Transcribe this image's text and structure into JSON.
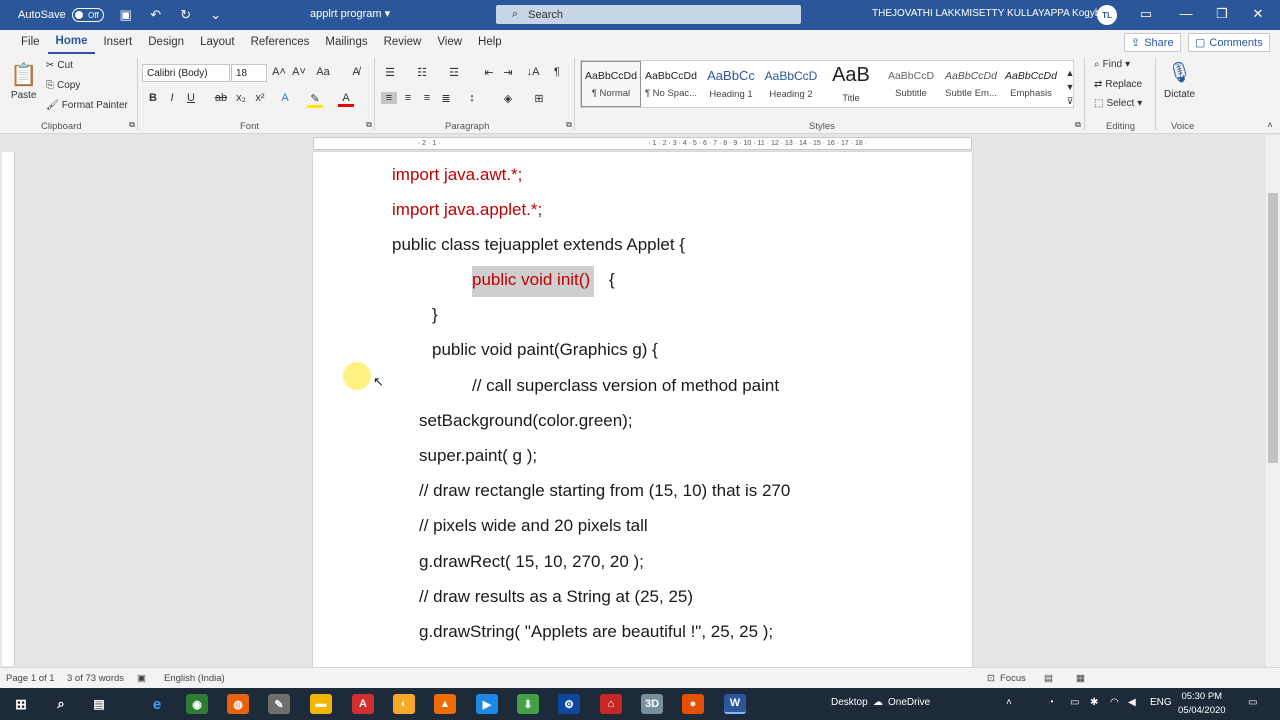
{
  "titlebar": {
    "autosave_label": "AutoSave",
    "autosave_state": "Off",
    "doc_title": "applrt program",
    "search_placeholder": "Search",
    "user_name": "THEJOVATHI LAKKMISETTY KULLAYAPPA Kogybia",
    "user_initials": "TL"
  },
  "tabs": [
    "File",
    "Home",
    "Insert",
    "Design",
    "Layout",
    "References",
    "Mailings",
    "Review",
    "View",
    "Help"
  ],
  "active_tab": "Home",
  "share_label": "Share",
  "comments_label": "Comments",
  "clipboard": {
    "paste": "Paste",
    "cut": "Cut",
    "copy": "Copy",
    "format_painter": "Format Painter",
    "label": "Clipboard"
  },
  "font": {
    "name": "Calibri (Body)",
    "size": "18",
    "label": "Font"
  },
  "paragraph_label": "Paragraph",
  "styles": [
    {
      "preview": "AaBbCcDd",
      "name": "¶ Normal"
    },
    {
      "preview": "AaBbCcDd",
      "name": "¶ No Spac..."
    },
    {
      "preview": "AaBbCc",
      "name": "Heading 1"
    },
    {
      "preview": "AaBbCcD",
      "name": "Heading 2"
    },
    {
      "preview": "AaB",
      "name": "Title"
    },
    {
      "preview": "AaBbCcD",
      "name": "Subtitle"
    },
    {
      "preview": "AaBbCcDd",
      "name": "Subtle Em..."
    },
    {
      "preview": "AaBbCcDd",
      "name": "Emphasis"
    }
  ],
  "styles_label": "Styles",
  "editing": {
    "find": "Find",
    "replace": "Replace",
    "select": "Select",
    "label": "Editing"
  },
  "voice": {
    "dictate": "Dictate",
    "label": "Voice"
  },
  "document": {
    "lines": [
      "import java.awt.*;",
      "import java.applet.*;",
      "public class tejuapplet extends Applet {",
      "public void init()",
      "{",
      "}",
      "public void paint(Graphics g) {",
      "// call superclass version of method paint",
      "setBackground(color.green);",
      "super.paint( g );",
      "// draw rectangle starting from (15, 10) that is 270",
      "// pixels wide and 20 pixels tall",
      "g.drawRect( 15, 10, 270, 20 );",
      "// draw results as a String at (25, 25)",
      "g.drawString( \"Applets are beautiful !\", 25, 25 );"
    ]
  },
  "status": {
    "page": "Page 1 of 1",
    "words": "3 of 73 words",
    "language": "English (India)",
    "focus": "Focus"
  },
  "taskbar": {
    "desktop": "Desktop",
    "onedrive": "OneDrive",
    "lang": "ENG",
    "time": "05:30 PM",
    "date": "05/04/2020"
  },
  "colors": {
    "word_blue": "#2b579a",
    "code_red": "#c00000"
  }
}
